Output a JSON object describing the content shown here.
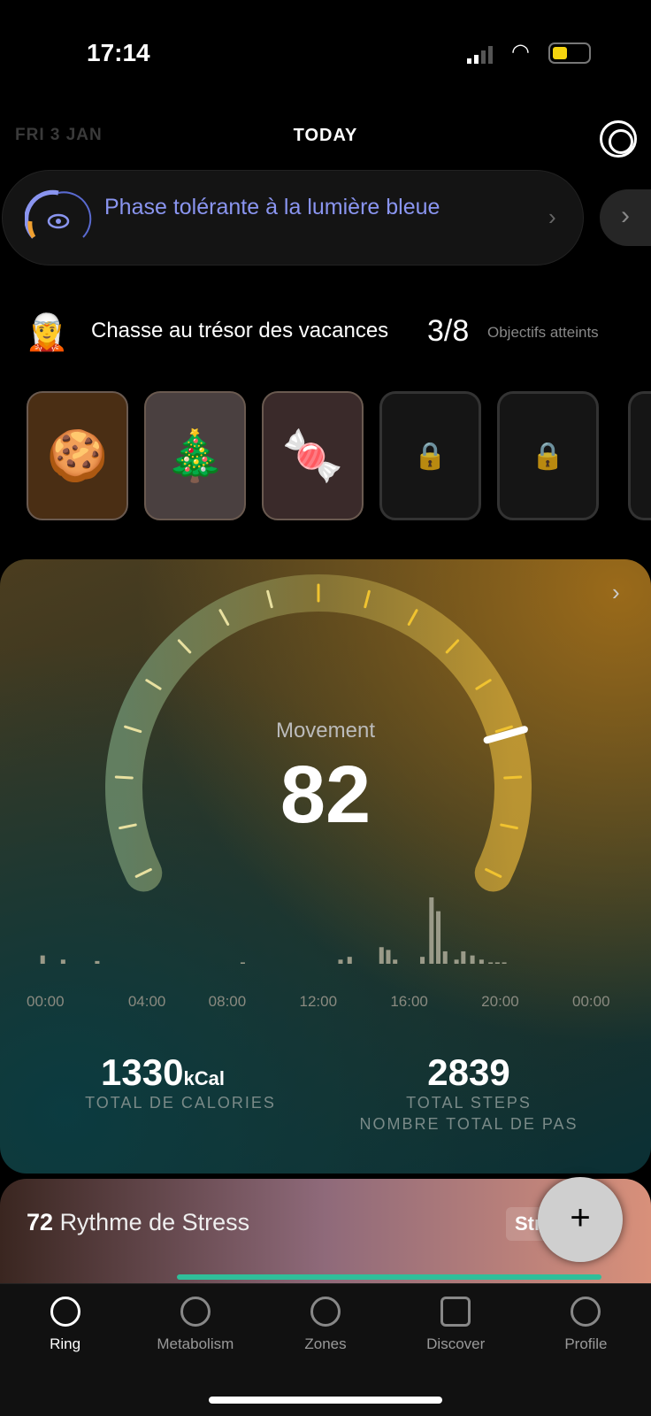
{
  "status": {
    "time": "17:14"
  },
  "header": {
    "date": "FRI 3 JAN",
    "title": "TODAY"
  },
  "phase": {
    "text": "Phase tolérante à la lumière bleue",
    "icon": "eye-icon"
  },
  "hunt": {
    "title": "Chasse au trésor des vacances",
    "count": "3/8",
    "goals": "Objectifs atteints",
    "items": [
      {
        "emoji": "🍪",
        "locked": false
      },
      {
        "emoji": "🎄",
        "locked": false
      },
      {
        "emoji": "🍬",
        "locked": false
      },
      {
        "emoji": "🔒",
        "locked": true
      },
      {
        "emoji": "🔒",
        "locked": true
      }
    ]
  },
  "movement": {
    "label": "Movement",
    "score": "82",
    "score_pct": 82,
    "accent": "#f0c330",
    "calories": "1330",
    "calories_unit": "kCal",
    "calories_label": "TOTAL DE CALORIES",
    "steps": "2839",
    "steps_label1": "TOTAL STEPS",
    "steps_label2": "NOMBRE TOTAL DE PAS",
    "ticks": [
      "00:00",
      "04:00",
      "08:00",
      "12:00",
      "16:00",
      "20:00",
      "00:00"
    ]
  },
  "chart_data": {
    "type": "bar",
    "x_hours": [
      0.3,
      1.2,
      2.7,
      9.1,
      13.4,
      13.8,
      15.2,
      15.5,
      15.8,
      17.0,
      17.4,
      17.7,
      18.0,
      18.5,
      18.8,
      19.2,
      19.6,
      20.0,
      20.3,
      20.6
    ],
    "values": [
      6,
      3,
      2,
      1,
      3,
      5,
      12,
      10,
      3,
      5,
      48,
      38,
      9,
      3,
      9,
      6,
      3,
      1,
      1,
      1
    ],
    "xlim": [
      "00:00",
      "00:00"
    ]
  },
  "stress": {
    "value": "72",
    "label": "Rythme de Stress",
    "badge": "Str"
  },
  "fab": {
    "label": "+"
  },
  "nav": [
    {
      "label": "Ring"
    },
    {
      "label": "Metabolism"
    },
    {
      "label": "Zones"
    },
    {
      "label": "Discover"
    },
    {
      "label": "Profile"
    }
  ]
}
